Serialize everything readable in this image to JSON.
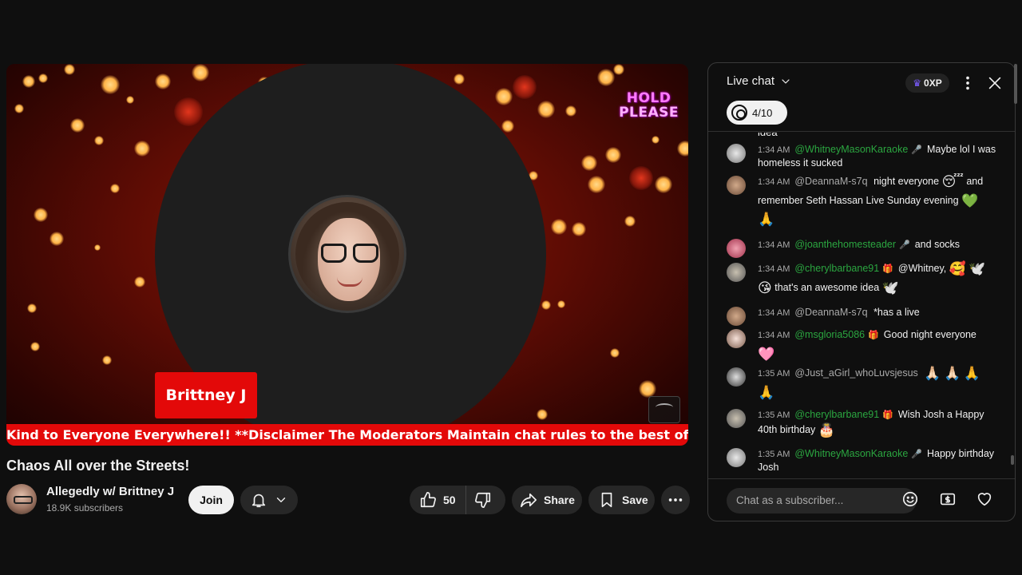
{
  "video": {
    "overlay_text": [
      "HOLD",
      "PLEASE"
    ],
    "name_tag": "Brittney J",
    "ticker": "Kind to Everyone Everywhere!! **Disclaimer The Moderators Maintain chat rules to the best of their"
  },
  "title": "Chaos All over the Streets!",
  "channel": {
    "name": "Allegedly w/ Brittney J",
    "subscribers": "18.9K subscribers",
    "join_label": "Join"
  },
  "actions": {
    "likes": "50",
    "share_label": "Share",
    "save_label": "Save"
  },
  "chat": {
    "title": "Live chat",
    "xp": "0XP",
    "goal": "4/10",
    "cut_text": "idea",
    "input_placeholder": "Chat as a subscriber...",
    "messages": [
      {
        "time": "1:34 AM",
        "author": "@WhitneyMasonKaraoke",
        "badge": "🎤",
        "text": "Maybe lol I was homeless it sucked",
        "author_color": "green"
      },
      {
        "time": "1:34 AM",
        "author": "@DeannaM-s7q",
        "badge": "",
        "text": "night everyone",
        "emoji1": "😴",
        "text2": "and remember Seth Hassan Live Sunday evening",
        "emoji2": "💚",
        "emoji3": "🙏",
        "author_color": "plain"
      },
      {
        "time": "1:34 AM",
        "author": "@joanthehomesteader",
        "badge": "🎤",
        "text": "and socks",
        "author_color": "green"
      },
      {
        "time": "1:34 AM",
        "author": "@cherylbarbane91",
        "badge": "🎁",
        "text": "@Whitney,",
        "emoji1": "🥰",
        "emoji2": "🕊️",
        "emoji3": "😘",
        "text2": "that's an awesome idea",
        "emoji4": "🕊️",
        "author_color": "green"
      },
      {
        "time": "1:34 AM",
        "author": "@DeannaM-s7q",
        "badge": "",
        "text": "*has a live",
        "author_color": "plain"
      },
      {
        "time": "1:34 AM",
        "author": "@msgloria5086",
        "badge": "🎁",
        "text": "Good night everyone",
        "emoji1": "🩷",
        "author_color": "green"
      },
      {
        "time": "1:35 AM",
        "author": "@Just_aGirl_whoLuvsjesus",
        "badge": "",
        "emoji1": "🙏🏻",
        "emoji2": "🙏🏻",
        "emoji3": "🙏",
        "emoji4": "🙏",
        "author_color": "plain"
      },
      {
        "time": "1:35 AM",
        "author": "@cherylbarbane91",
        "badge": "🎁",
        "text": "Wish Josh a Happy 40th birthday",
        "emoji1": "🎂",
        "author_color": "green"
      },
      {
        "time": "1:35 AM",
        "author": "@WhitneyMasonKaraoke",
        "badge": "🎤",
        "text": "Happy birthday Josh",
        "author_color": "green"
      }
    ]
  }
}
